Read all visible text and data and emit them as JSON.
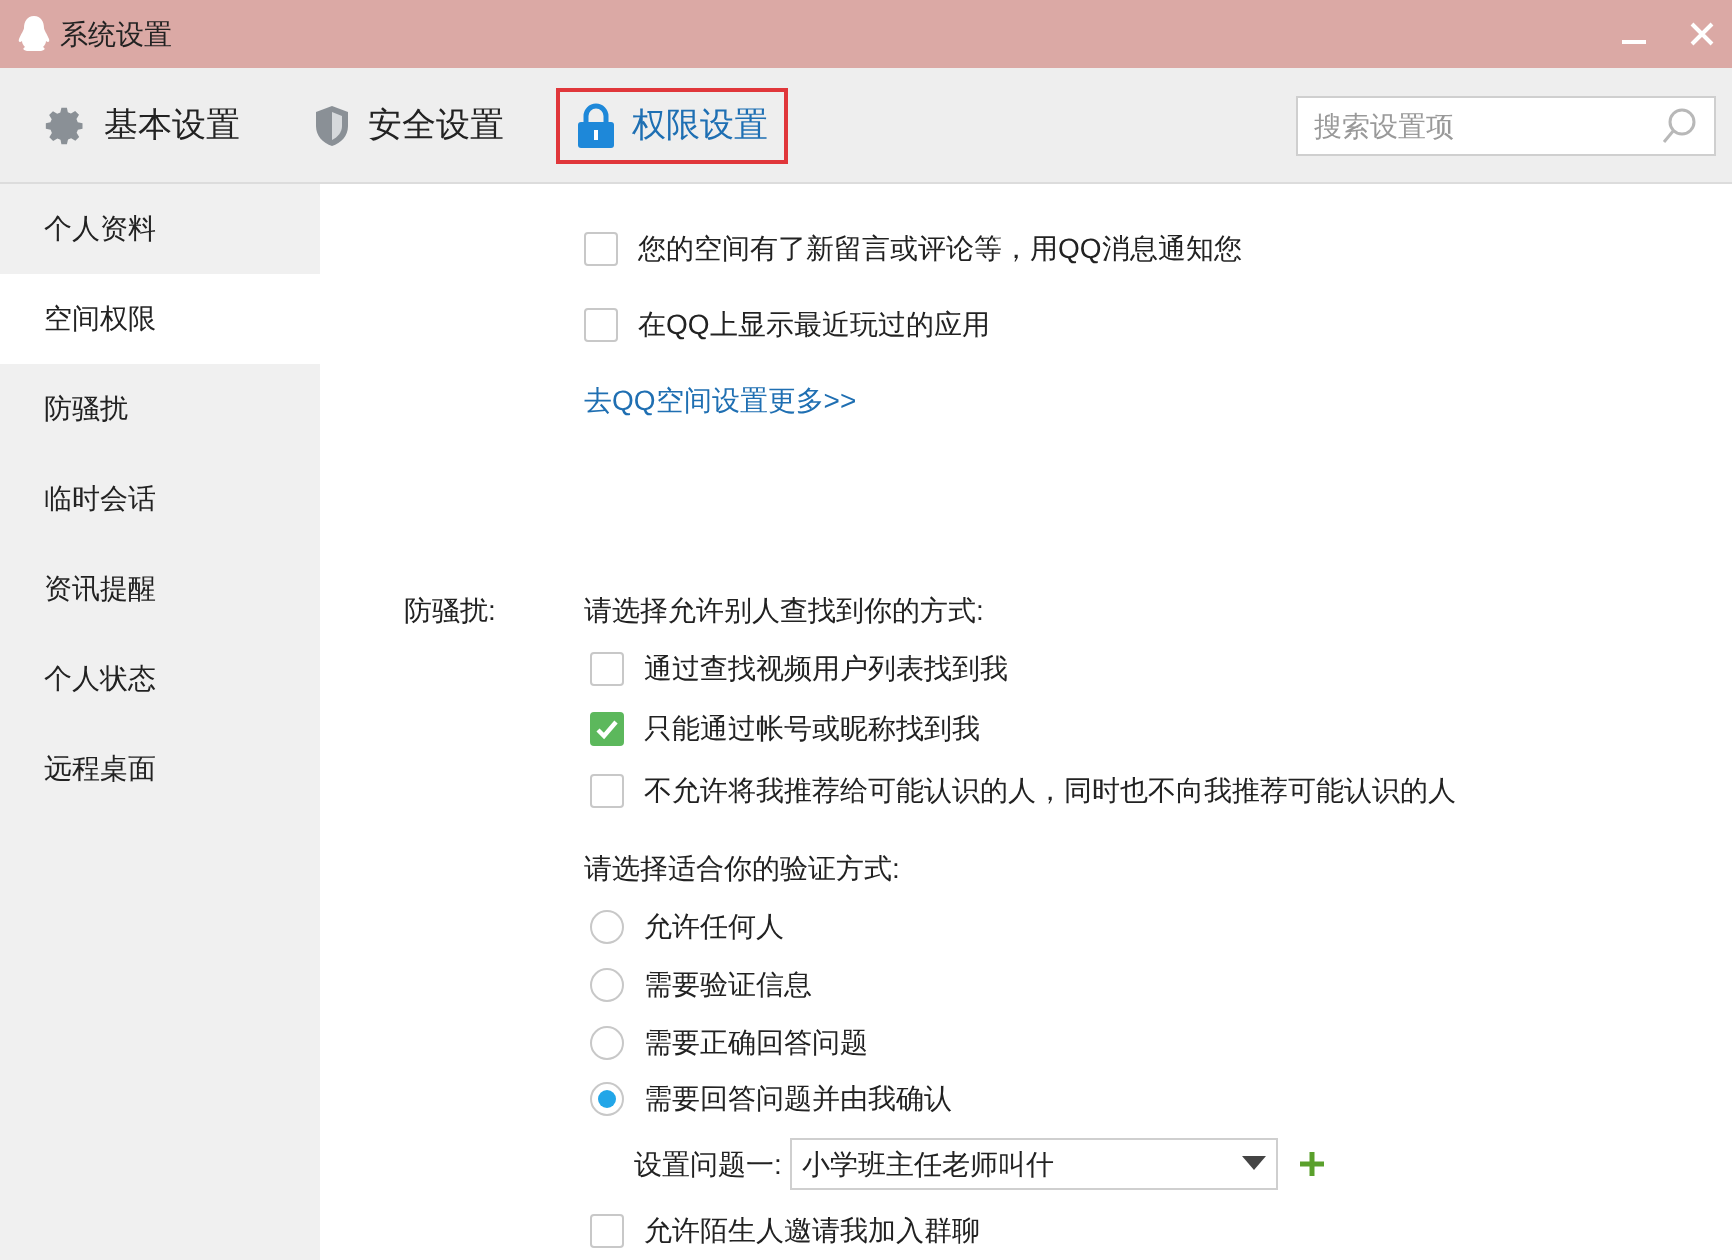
{
  "window": {
    "title": "系统设置"
  },
  "tabs": [
    {
      "label": "基本设置",
      "kind": "gear",
      "selected": false
    },
    {
      "label": "安全设置",
      "kind": "shield",
      "selected": false
    },
    {
      "label": "权限设置",
      "kind": "lock",
      "selected": true
    }
  ],
  "search": {
    "placeholder": "搜索设置项"
  },
  "sidebar": {
    "items": [
      {
        "label": "个人资料",
        "selected": false
      },
      {
        "label": "空间权限",
        "selected": true
      },
      {
        "label": "防骚扰",
        "selected": false
      },
      {
        "label": "临时会话",
        "selected": false
      },
      {
        "label": "资讯提醒",
        "selected": false
      },
      {
        "label": "个人状态",
        "selected": false
      },
      {
        "label": "远程桌面",
        "selected": false
      }
    ]
  },
  "space_options": [
    {
      "label": "您的空间有了新留言或评论等，用QQ消息通知您",
      "checked": false
    },
    {
      "label": "在QQ上显示最近玩过的应用",
      "checked": false
    }
  ],
  "space_link": "去QQ空间设置更多>>",
  "anti_harass": {
    "label": "防骚扰:",
    "find_heading": "请选择允许别人查找到你的方式:",
    "find_options": [
      {
        "label": "通过查找视频用户列表找到我",
        "checked": false
      },
      {
        "label": "只能通过帐号或昵称找到我",
        "checked": true
      },
      {
        "label": "不允许将我推荐给可能认识的人，同时也不向我推荐可能认识的人",
        "checked": false
      }
    ],
    "verify_heading": "请选择适合你的验证方式:",
    "verify_options": [
      {
        "label": "允许任何人",
        "selected": false
      },
      {
        "label": "需要验证信息",
        "selected": false
      },
      {
        "label": "需要正确回答问题",
        "selected": false
      },
      {
        "label": "需要回答问题并由我确认",
        "selected": true
      }
    ],
    "question_label": "设置问题一:",
    "question_value": "小学班主任老师叫什",
    "extra_options": [
      {
        "label": "允许陌生人邀请我加入群聊",
        "checked": false
      }
    ]
  }
}
